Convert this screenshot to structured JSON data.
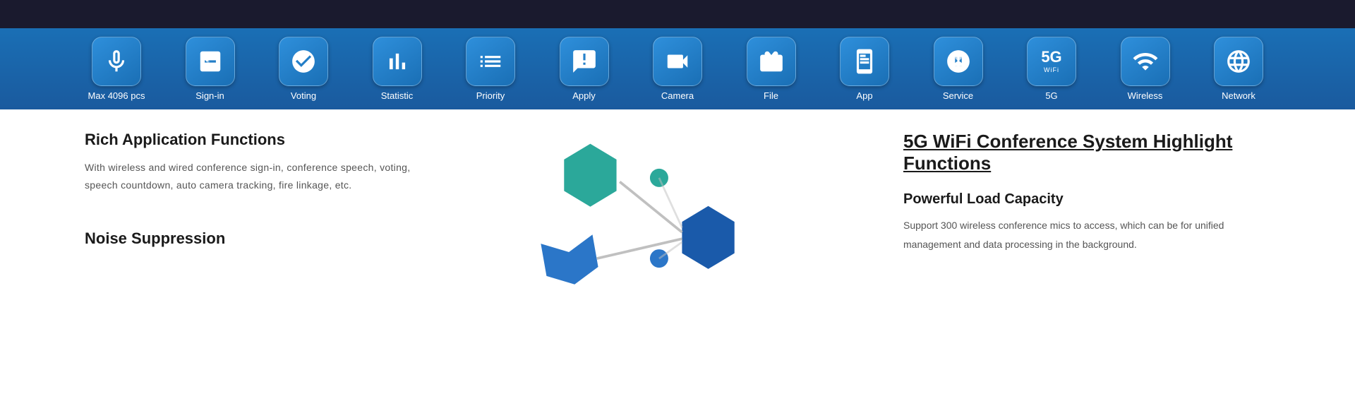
{
  "topBar": {
    "height": 40
  },
  "iconBar": {
    "items": [
      {
        "id": "max4096",
        "label": "Max 4096 pcs",
        "icon": "mic"
      },
      {
        "id": "signin",
        "label": "Sign-in",
        "icon": "signin"
      },
      {
        "id": "voting",
        "label": "Voting",
        "icon": "voting"
      },
      {
        "id": "statistic",
        "label": "Statistic",
        "icon": "statistic"
      },
      {
        "id": "priority",
        "label": "Priority",
        "icon": "priority"
      },
      {
        "id": "apply",
        "label": "Apply",
        "icon": "apply"
      },
      {
        "id": "camera",
        "label": "Camera",
        "icon": "camera"
      },
      {
        "id": "file",
        "label": "File",
        "icon": "file"
      },
      {
        "id": "app",
        "label": "App",
        "icon": "app"
      },
      {
        "id": "service",
        "label": "Service",
        "icon": "service"
      },
      {
        "id": "fiveg",
        "label": "5G",
        "icon": "5g"
      },
      {
        "id": "wireless",
        "label": "Wireless",
        "icon": "wireless"
      },
      {
        "id": "network",
        "label": "Network",
        "icon": "network"
      }
    ]
  },
  "leftSection": {
    "richTitle": "Rich Application Functions",
    "richText": "With wireless and wired conference sign-in, conference speech, voting, speech countdown, auto camera tracking, fire linkage, etc.",
    "noiseTitle": "Noise Suppression"
  },
  "rightSection": {
    "highlightTitle": "5G WiFi Conference System  Highlight Functions",
    "powerTitle": "Powerful Load Capacity",
    "powerText": "Support 300 wireless conference mics to access, which can be  for unified management and data processing in the background."
  }
}
